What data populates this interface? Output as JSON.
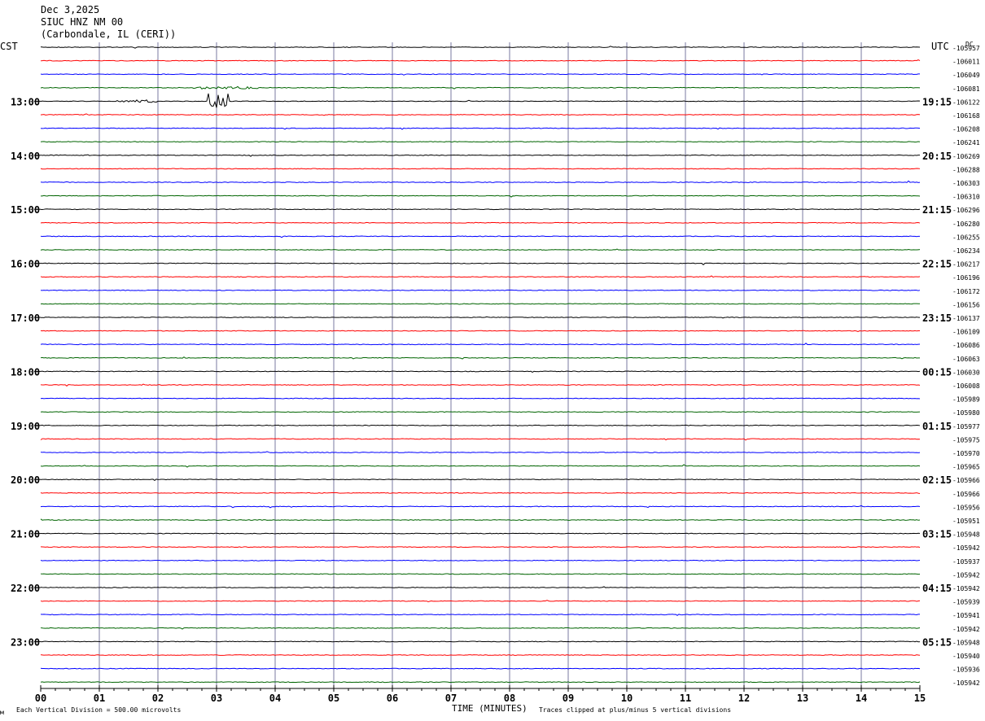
{
  "header": {
    "date": "Dec 3,2025",
    "station": "SIUC HNZ NM 00",
    "location": "(Carbondale, IL (CERI))"
  },
  "left_axis_title": "CST",
  "right_axis_title": "UTC",
  "dc_label": "DC",
  "footer": {
    "scale_note": "Each Vertical Division =  500.00 microvolts",
    "clip_note": "Traces clipped at plus/minus 5 vertical divisions",
    "mark": "м"
  },
  "colors": {
    "trace_cycle": [
      "#000000",
      "#ff0000",
      "#0000ff",
      "#006400"
    ],
    "minute_grid": "#7a7aa0"
  },
  "chart_data": {
    "type": "line",
    "title": "SIUC HNZ NM 00",
    "xlabel": "TIME (MINUTES)",
    "ylabel": "",
    "x_ticks": [
      "00",
      "01",
      "02",
      "03",
      "04",
      "05",
      "06",
      "07",
      "08",
      "09",
      "10",
      "11",
      "12",
      "13",
      "14",
      "15"
    ],
    "xlim": [
      0,
      15
    ],
    "traces_per_hour": 4,
    "left_hour_labels": [
      "13:00",
      "14:00",
      "15:00",
      "16:00",
      "17:00",
      "18:00",
      "19:00",
      "20:00",
      "21:00",
      "22:00",
      "23:00"
    ],
    "right_hour_labels": [
      "19:15",
      "20:15",
      "21:15",
      "22:15",
      "23:15",
      "00:15",
      "01:15",
      "02:15",
      "03:15",
      "04:15",
      "05:15"
    ],
    "dc_offsets": [
      "-105957",
      "-106011",
      "-106049",
      "-106081",
      "-106122",
      "-106168",
      "-106208",
      "-106241",
      "-106269",
      "-106288",
      "-106303",
      "-106310",
      "-106296",
      "-106280",
      "-106255",
      "-106234",
      "-106217",
      "-106196",
      "-106172",
      "-106156",
      "-106137",
      "-106109",
      "-106086",
      "-106063",
      "-106030",
      "-106008",
      "-105989",
      "-105980",
      "-105977",
      "-105975",
      "-105970",
      "-105965",
      "-105966",
      "-105966",
      "-105956",
      "-105951",
      "-105948",
      "-105942",
      "-105937",
      "-105942",
      "-105942",
      "-105939",
      "-105941",
      "-105942",
      "-105948",
      "-105940",
      "-105936",
      "-105942"
    ],
    "events": [
      {
        "trace": 4,
        "start_min": 2.85,
        "end_min": 3.2,
        "amplitude": 1.6,
        "note": "largest transient"
      },
      {
        "trace": 3,
        "start_min": 2.6,
        "end_min": 3.7,
        "amplitude": 0.25
      },
      {
        "trace": 4,
        "start_min": 1.3,
        "end_min": 2.0,
        "amplitude": 0.2
      }
    ],
    "grid": true
  }
}
